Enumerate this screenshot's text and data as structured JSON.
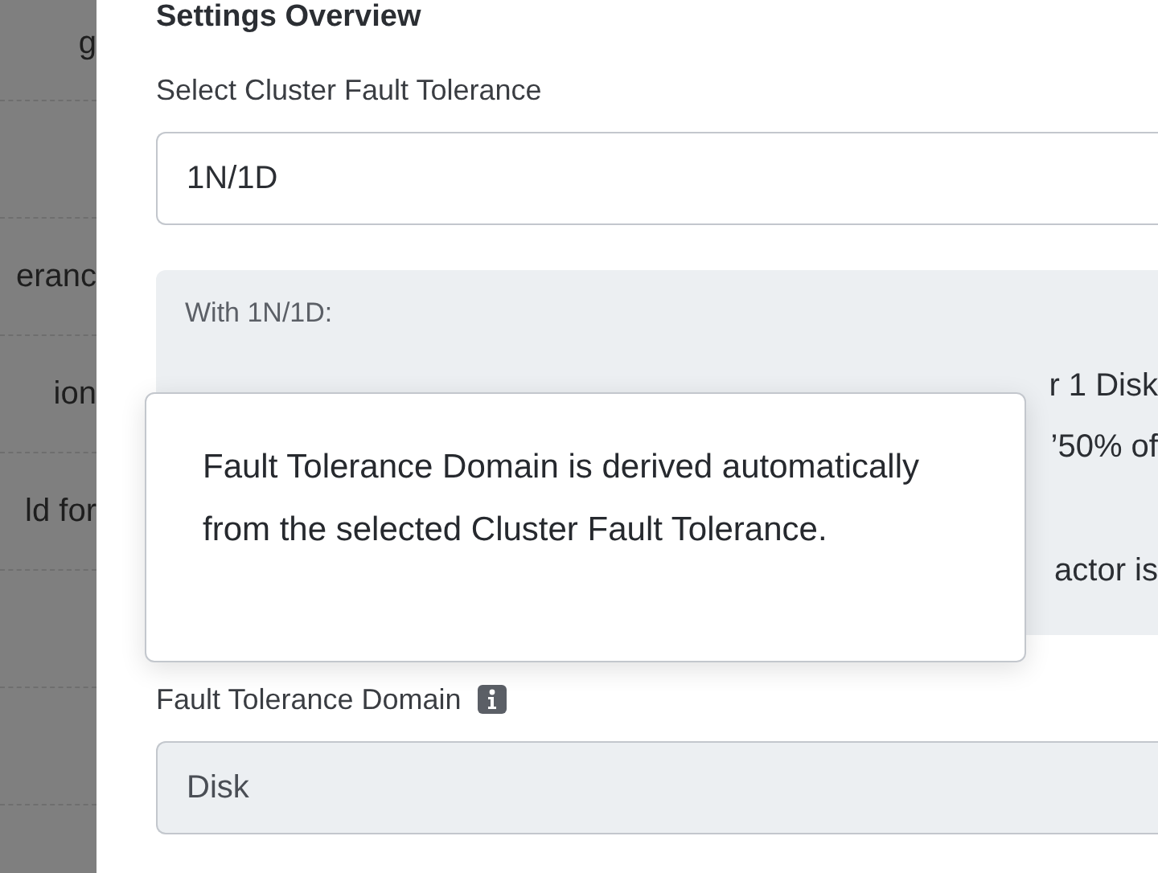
{
  "sidebar": {
    "items": [
      {
        "kind": "text",
        "label": "g"
      },
      {
        "kind": "blank"
      },
      {
        "kind": "text",
        "label": "eranc"
      },
      {
        "kind": "text",
        "label": "ion"
      },
      {
        "kind": "text",
        "label": "ld for"
      },
      {
        "kind": "blank"
      },
      {
        "kind": "blank"
      },
      {
        "kind": "blank"
      }
    ]
  },
  "heading": "Settings Overview",
  "cluster_fault_tolerance": {
    "label": "Select Cluster Fault Tolerance",
    "value": "1N/1D"
  },
  "info_box": {
    "title": "With 1N/1D:",
    "lines": [
      {
        "kind": "text",
        "text": "r 1 Disk"
      },
      {
        "kind": "text",
        "text": "’50% of"
      },
      {
        "kind": "blank"
      },
      {
        "kind": "text",
        "text": "actor is"
      }
    ]
  },
  "tooltip": {
    "text": "Fault Tolerance Domain is derived automatically from the selected Cluster Fault Tolerance."
  },
  "fault_tolerance_domain": {
    "label": "Fault Tolerance Domain",
    "value": "Disk",
    "disabled": true
  }
}
